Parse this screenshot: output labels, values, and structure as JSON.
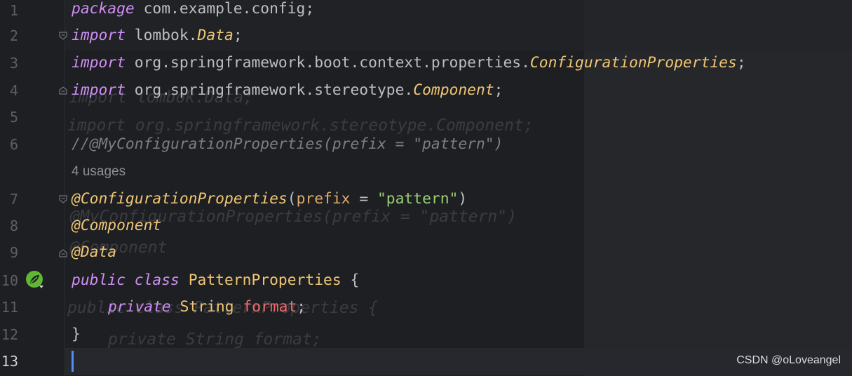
{
  "editor": {
    "line_numbers": [
      "1",
      "2",
      "3",
      "4",
      "5",
      "6",
      "7",
      "8",
      "9",
      "10",
      "11",
      "12",
      "13"
    ],
    "usages_hint": "4 usages",
    "watermark": "CSDN @oLoveangel"
  },
  "code": {
    "l1": {
      "kw": "package",
      "rest": " com.example.config;"
    },
    "l2": {
      "kw": "import",
      "pkg": " lombok.",
      "type": "Data",
      "end": ";"
    },
    "l3": {
      "kw": "import",
      "pkg": " org.springframework.boot.context.properties.",
      "type": "ConfigurationProperties",
      "end": ";"
    },
    "l4": {
      "kw": "import",
      "pkg": " org.springframework.stereotype.",
      "type": "Component",
      "end": ";"
    },
    "l6": {
      "comment": "//@MyConfigurationProperties(prefix = \"pattern\")"
    },
    "l7": {
      "ann": "@ConfigurationProperties",
      "open": "(",
      "param": "prefix",
      "eq": " = ",
      "str": "\"pattern\"",
      "close": ")"
    },
    "l8": {
      "ann": "@Component"
    },
    "l9": {
      "ann": "@Data"
    },
    "l10": {
      "kw1": "public",
      "kw2": "class",
      "cls": "PatternProperties",
      "brace": " {"
    },
    "l11": {
      "kw": "private",
      "type": "String",
      "field": "format",
      "end": ";"
    },
    "l12": {
      "brace": "}"
    }
  },
  "ghost": {
    "g1": "import lombok.Data;",
    "g2": "import org.springframework.stereotype.Component;",
    "g3": "@MyConfigurationProperties(prefix = \"pattern\")",
    "g4": "@Component",
    "g5": "public class PatternProperties {",
    "g6": "private String format;"
  },
  "colors": {
    "keyword": "#cf8ef4",
    "annotation": "#f0c674",
    "string": "#9ad075",
    "field": "#ed6b6b",
    "comment": "#7a7e85",
    "caret": "#4e8ef5"
  },
  "icons": {
    "bean": "spring-bean-icon",
    "fold": "fold-marker-icon"
  }
}
